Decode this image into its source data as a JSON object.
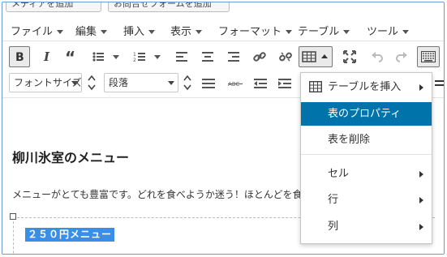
{
  "top_buttons": {
    "add_media": "メディアを追加",
    "add_form": "お問合せフォームを追加"
  },
  "menubar": {
    "items": [
      {
        "label": "ファイル"
      },
      {
        "label": "編集"
      },
      {
        "label": "挿入"
      },
      {
        "label": "表示"
      },
      {
        "label": "フォーマット"
      },
      {
        "label": "テーブル"
      },
      {
        "label": "ツール"
      }
    ]
  },
  "toolbar": {
    "font_size": "フォントサイズ",
    "block_format": "段落",
    "icons": [
      "bold-icon",
      "italic-icon",
      "blockquote-icon",
      "bullet-list-icon",
      "numbered-list-icon",
      "align-left-icon",
      "align-center-icon",
      "align-right-icon",
      "link-icon",
      "unlink-icon",
      "table-icon",
      "fullscreen-icon",
      "undo-icon",
      "redo-icon",
      "toolbar-toggle-icon",
      "hr-icon",
      "strikethrough-icon",
      "outdent-icon",
      "indent-icon"
    ]
  },
  "content": {
    "heading": "柳川氷室のメニュー",
    "paragraph": "メニューがとても豊富です。どれを食べようか迷う！ほとんどを食べてみました。",
    "selected_cell": "２５０円メニュー"
  },
  "table_menu": {
    "insert_table": "テーブルを挿入",
    "table_properties": "表のプロパティ",
    "delete_table": "表を削除",
    "cell": "セル",
    "row": "行",
    "column": "列"
  },
  "colors": {
    "accent": "#0073aa",
    "selection": "#3a8ee6",
    "frame": "#6b9bd8"
  }
}
